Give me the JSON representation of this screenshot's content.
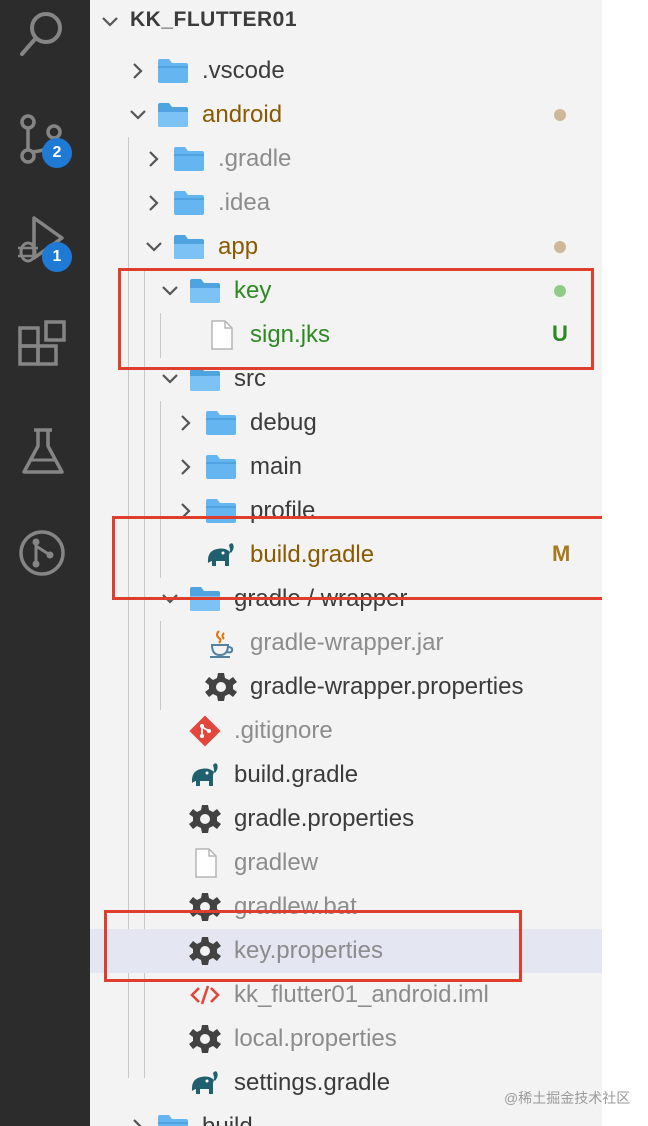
{
  "activity_bar": {
    "badges": {
      "source_control": "2",
      "run_debug": "1"
    },
    "icons": [
      "search-icon",
      "source-control-icon",
      "run-debug-icon",
      "extensions-icon",
      "testing-flask-icon",
      "git-graph-icon"
    ]
  },
  "explorer": {
    "section_title": "KK_FLUTTER01",
    "rows": [
      {
        "label": ".vscode",
        "icon": "folder-icon",
        "chevron": "right",
        "color": "#3b3b3b"
      },
      {
        "label": "android",
        "icon": "folder-open-icon",
        "chevron": "down",
        "color": "#8a5a00",
        "dot": "#cdb998"
      },
      {
        "label": ".gradle",
        "icon": "folder-icon",
        "chevron": "right",
        "color": "#8c8c8c"
      },
      {
        "label": ".idea",
        "icon": "folder-icon",
        "chevron": "right",
        "color": "#8c8c8c"
      },
      {
        "label": "app",
        "icon": "folder-open-icon",
        "chevron": "down",
        "color": "#8a5a00",
        "dot": "#cdb998"
      },
      {
        "label": "key",
        "icon": "folder-open-icon",
        "chevron": "down",
        "color": "#2d8a22",
        "dot": "#8fca87"
      },
      {
        "label": "sign.jks",
        "icon": "file-icon",
        "color": "#2d8a22",
        "decoration": "U",
        "decoration_color": "#2d8a22"
      },
      {
        "label": "src",
        "icon": "folder-open-icon",
        "chevron": "down",
        "color": "#3b3b3b"
      },
      {
        "label": "debug",
        "icon": "folder-icon",
        "chevron": "right",
        "color": "#3b3b3b"
      },
      {
        "label": "main",
        "icon": "folder-icon",
        "chevron": "right",
        "color": "#3b3b3b"
      },
      {
        "label": "profile",
        "icon": "folder-icon",
        "chevron": "right",
        "color": "#3b3b3b"
      },
      {
        "label": "build.gradle",
        "icon": "gradle-elephant-icon",
        "color": "#8a5a00",
        "decoration": "M",
        "decoration_color": "#a87a1e"
      },
      {
        "label": "gradle / wrapper",
        "icon": "folder-open-icon",
        "chevron": "down",
        "color": "#3b3b3b"
      },
      {
        "label": "gradle-wrapper.jar",
        "icon": "java-coffee-icon",
        "color": "#8c8c8c"
      },
      {
        "label": "gradle-wrapper.properties",
        "icon": "gear-icon",
        "color": "#3b3b3b"
      },
      {
        "label": ".gitignore",
        "icon": "git-icon",
        "color": "#8c8c8c"
      },
      {
        "label": "build.gradle",
        "icon": "gradle-elephant-icon",
        "color": "#3b3b3b"
      },
      {
        "label": "gradle.properties",
        "icon": "gear-icon",
        "color": "#3b3b3b"
      },
      {
        "label": "gradlew",
        "icon": "file-icon",
        "color": "#8c8c8c"
      },
      {
        "label": "gradlew.bat",
        "icon": "gear-icon",
        "color": "#8c8c8c"
      },
      {
        "label": "key.properties",
        "icon": "gear-icon",
        "color": "#8c8c8c"
      },
      {
        "label": "kk_flutter01_android.iml",
        "icon": "code-file-icon",
        "color": "#8c8c8c"
      },
      {
        "label": "local.properties",
        "icon": "gear-icon",
        "color": "#8c8c8c"
      },
      {
        "label": "settings.gradle",
        "icon": "gradle-elephant-icon",
        "color": "#3b3b3b"
      },
      {
        "label": "build",
        "icon": "folder-icon",
        "chevron": "right",
        "color": "#3b3b3b"
      }
    ]
  },
  "watermark": "@稀土掘金技术社区",
  "colors": {
    "highlight": "#e03e2d",
    "selection": "#e4e6f1",
    "folder": "#64b5f0"
  }
}
